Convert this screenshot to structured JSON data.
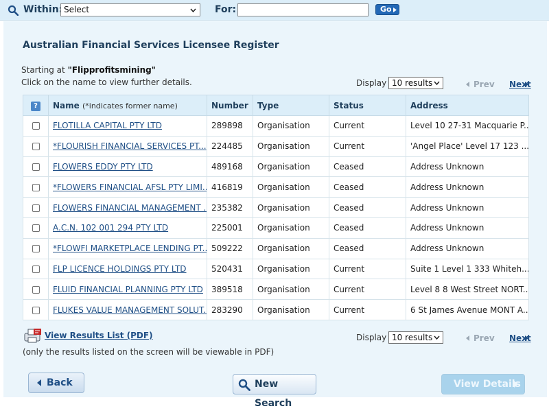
{
  "search_bar": {
    "within_label": "Within:",
    "within_value": "Select",
    "for_label": "For:",
    "for_value": "",
    "go_label": "Go"
  },
  "page": {
    "title": "Australian Financial Services Licensee Register",
    "starting_prefix": "Starting at",
    "starting_term": "\"Flipprofitsmining\"",
    "click_hint": "Click on the name to view further details."
  },
  "display": {
    "label": "Display",
    "value": "10 results"
  },
  "pager": {
    "prev_label": "Prev",
    "next_label": "Next"
  },
  "table": {
    "headers": {
      "help": "?",
      "name": "Name",
      "name_note": "(*indicates former name)",
      "number": "Number",
      "type": "Type",
      "status": "Status",
      "address": "Address"
    },
    "rows": [
      {
        "name": "FLOTILLA CAPITAL PTY LTD",
        "number": "289898",
        "type": "Organisation",
        "status": "Current",
        "address": "Level 10 27-31 Macquarie P..."
      },
      {
        "name": "*FLOURISH FINANCIAL SERVICES PT...",
        "number": "224485",
        "type": "Organisation",
        "status": "Current",
        "address": "'Angel Place' Level 17 123 ..."
      },
      {
        "name": "FLOWERS EDDY PTY LTD",
        "number": "489168",
        "type": "Organisation",
        "status": "Ceased",
        "address": "Address Unknown"
      },
      {
        "name": "*FLOWERS FINANCIAL AFSL PTY LIMI...",
        "number": "416819",
        "type": "Organisation",
        "status": "Ceased",
        "address": "Address Unknown"
      },
      {
        "name": "FLOWERS FINANCIAL MANAGEMENT ...",
        "number": "235382",
        "type": "Organisation",
        "status": "Ceased",
        "address": "Address Unknown"
      },
      {
        "name": "A.C.N. 102 001 294 PTY LTD",
        "number": "225001",
        "type": "Organisation",
        "status": "Ceased",
        "address": "Address Unknown"
      },
      {
        "name": "*FLOWFI MARKETPLACE LENDING PT...",
        "number": "509222",
        "type": "Organisation",
        "status": "Ceased",
        "address": "Address Unknown"
      },
      {
        "name": "FLP LICENCE HOLDINGS PTY LTD",
        "number": "520431",
        "type": "Organisation",
        "status": "Current",
        "address": "Suite 1 Level 1 333 Whiteh..."
      },
      {
        "name": "FLUID FINANCIAL PLANNING PTY LTD",
        "number": "389518",
        "type": "Organisation",
        "status": "Current",
        "address": "Level 8 8 West Street NORT..."
      },
      {
        "name": "FLUKES VALUE MANAGEMENT SOLUT...",
        "number": "283290",
        "type": "Organisation",
        "status": "Current",
        "address": "6 St James Avenue MONT A..."
      }
    ]
  },
  "pdf": {
    "link_label": "View Results List (PDF)",
    "note": "(only the results listed on the screen will be viewable in PDF)"
  },
  "buttons": {
    "back": "Back",
    "new_search": "New Search",
    "view_details": "View Details"
  },
  "colors": {
    "panel_bg": "#ebf5fb",
    "header_bg": "#dceef9",
    "link": "#1f4f86",
    "go_button": "#2268b6"
  }
}
